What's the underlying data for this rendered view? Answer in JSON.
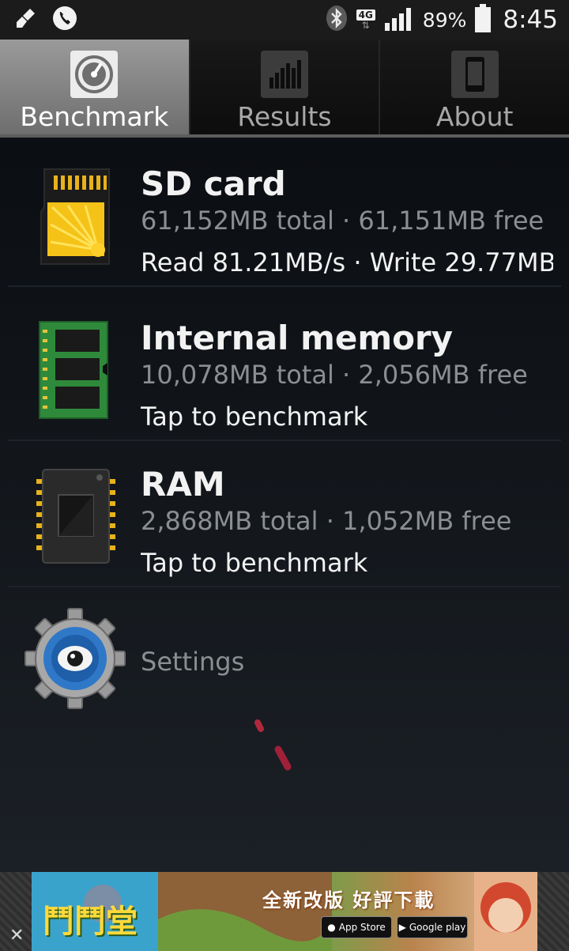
{
  "status_bar": {
    "battery_percent": "89%",
    "network_type": "4G",
    "time": "8:45",
    "icons": [
      "cleaner-icon",
      "phone-call-icon",
      "bluetooth-icon",
      "network-4g-icon",
      "signal-icon",
      "battery-icon"
    ]
  },
  "tabs": [
    {
      "label": "Benchmark",
      "icon": "speedometer-icon",
      "active": true
    },
    {
      "label": "Results",
      "icon": "bar-chart-icon",
      "active": false
    },
    {
      "label": "About",
      "icon": "phone-icon",
      "active": false
    }
  ],
  "items": [
    {
      "title": "SD card",
      "subtitle": "61,152MB total · 61,151MB free",
      "status": "Read 81.21MB/s · Write 29.77MB/s",
      "icon": "sd-card-icon"
    },
    {
      "title": "Internal memory",
      "subtitle": "10,078MB total · 2,056MB free",
      "status": "Tap to benchmark",
      "icon": "memory-module-icon"
    },
    {
      "title": "RAM",
      "subtitle": "2,868MB total · 1,052MB free",
      "status": "Tap to benchmark",
      "icon": "ram-chip-icon"
    }
  ],
  "settings": {
    "label": "Settings",
    "icon": "gear-icon"
  },
  "ad": {
    "headline": "全新改版 好評下載",
    "logo_text": "鬥鬥堂",
    "app_store_label": "App Store",
    "google_play_label": "Google play",
    "close_label": "✕"
  },
  "colors": {
    "background": "#0c0f13",
    "active_tab": "#8a8a8a",
    "subtitle_gray": "#8b8f93",
    "settings_blue": "#2f78c8"
  }
}
